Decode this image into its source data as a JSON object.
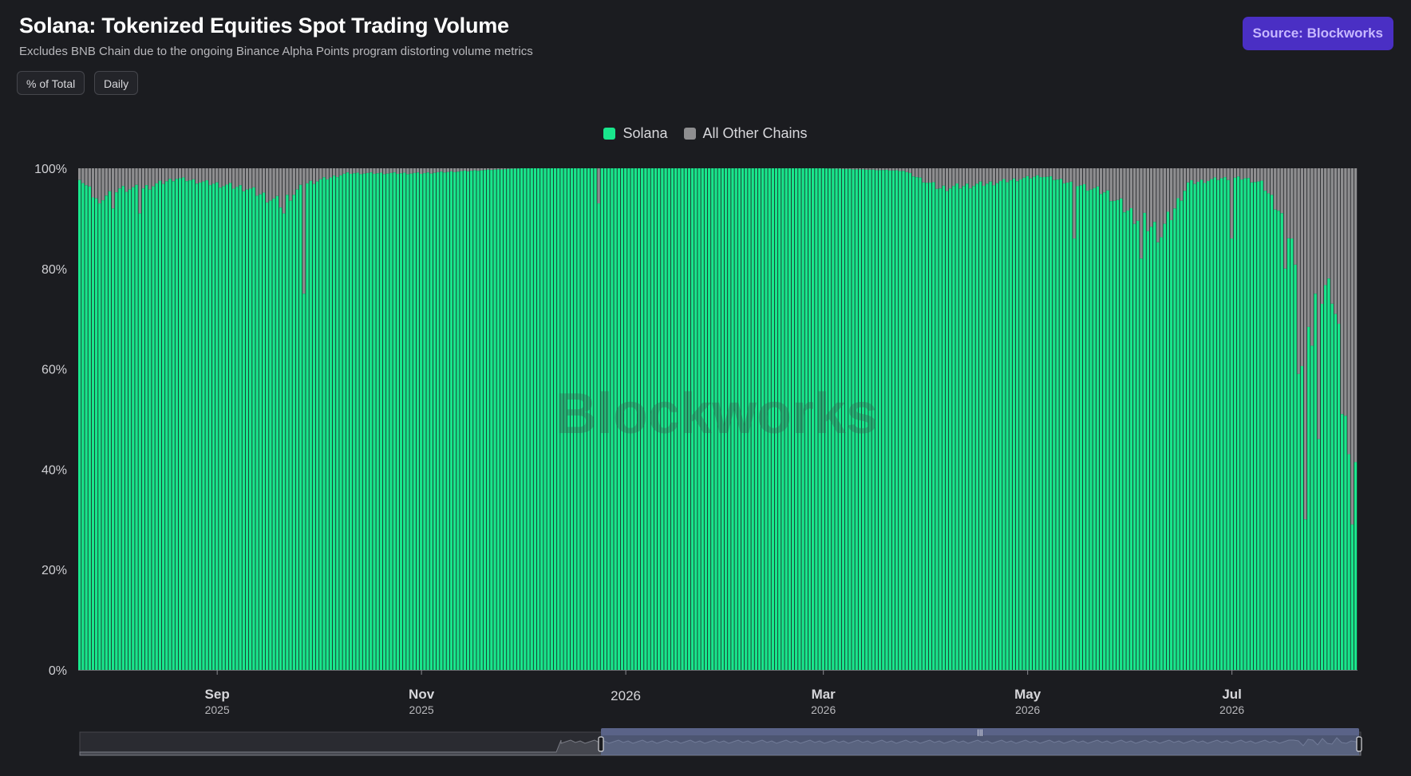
{
  "header": {
    "title": "Solana: Tokenized Equities Spot Trading Volume",
    "subtitle": "Excludes BNB Chain due to the ongoing Binance Alpha Points program distorting volume metrics",
    "source_label": "Source: Blockworks"
  },
  "controls": {
    "mode_label": "% of Total",
    "interval_label": "Daily"
  },
  "watermark": "Blockworks",
  "colors": {
    "solana": "#19e68c",
    "others": "#8e8e90",
    "background": "#1b1c20",
    "accent": "#4a2fc4"
  },
  "chart_data": {
    "type": "bar",
    "stacked": true,
    "normalized": "percent_of_total",
    "x_start": "2025-07-22",
    "x_end": "2026-08-07",
    "interval": "daily",
    "series": [
      {
        "name": "Solana",
        "color": "#19e68c"
      },
      {
        "name": "All Other Chains",
        "color": "#8e8e90"
      }
    ],
    "solana_share_keypoints": [
      [
        "2025-07-22",
        98
      ],
      [
        "2025-07-27",
        94
      ],
      [
        "2025-08-03",
        96
      ],
      [
        "2025-08-10",
        96
      ],
      [
        "2025-08-20",
        98
      ],
      [
        "2025-08-30",
        97
      ],
      [
        "2025-09-10",
        96
      ],
      [
        "2025-09-20",
        93
      ],
      [
        "2025-09-28",
        97
      ],
      [
        "2025-10-10",
        99
      ],
      [
        "2025-11-01",
        99
      ],
      [
        "2025-12-01",
        100
      ],
      [
        "2026-01-01",
        100
      ],
      [
        "2026-02-01",
        100
      ],
      [
        "2026-03-01",
        100
      ],
      [
        "2026-03-25",
        99.5
      ],
      [
        "2026-04-05",
        96
      ],
      [
        "2026-04-20",
        97
      ],
      [
        "2026-05-05",
        98.5
      ],
      [
        "2026-05-15",
        97
      ],
      [
        "2026-05-25",
        95
      ],
      [
        "2026-06-01",
        91
      ],
      [
        "2026-06-10",
        87
      ],
      [
        "2026-06-18",
        97
      ],
      [
        "2026-06-28",
        98
      ],
      [
        "2026-07-05",
        98
      ],
      [
        "2026-07-10",
        97
      ],
      [
        "2026-07-15",
        92
      ],
      [
        "2026-07-19",
        86
      ],
      [
        "2026-07-23",
        55
      ],
      [
        "2026-07-26",
        75
      ],
      [
        "2026-07-29",
        78
      ],
      [
        "2026-08-01",
        74
      ],
      [
        "2026-08-03",
        64
      ],
      [
        "2026-08-05",
        52
      ],
      [
        "2026-08-06",
        38
      ],
      [
        "2026-08-07",
        29
      ]
    ],
    "solana_share_dips": [
      [
        "2025-07-28",
        93
      ],
      [
        "2025-08-01",
        92
      ],
      [
        "2025-08-09",
        91
      ],
      [
        "2025-09-21",
        91
      ],
      [
        "2025-09-27",
        75
      ],
      [
        "2025-12-24",
        93
      ],
      [
        "2026-05-15",
        86
      ],
      [
        "2026-06-04",
        82
      ],
      [
        "2026-07-01",
        86
      ],
      [
        "2026-07-17",
        80
      ],
      [
        "2026-07-21",
        59
      ],
      [
        "2026-07-23",
        30
      ],
      [
        "2026-07-27",
        46
      ],
      [
        "2026-07-31",
        73
      ],
      [
        "2026-08-03",
        51
      ],
      [
        "2026-08-05",
        43
      ],
      [
        "2026-08-06",
        29
      ]
    ],
    "y_range": [
      0,
      100
    ],
    "y_ticks": [
      "0%",
      "20%",
      "40%",
      "60%",
      "80%",
      "100%"
    ],
    "x_ticks": [
      {
        "date": "2025-09-01",
        "label": "Sep",
        "sub": "2025"
      },
      {
        "date": "2025-11-01",
        "label": "Nov",
        "sub": "2025"
      },
      {
        "date": "2026-01-01",
        "label": "2026",
        "sub": ""
      },
      {
        "date": "2026-03-01",
        "label": "Mar",
        "sub": "2026"
      },
      {
        "date": "2026-05-01",
        "label": "May",
        "sub": "2026"
      },
      {
        "date": "2026-07-01",
        "label": "Jul",
        "sub": "2026"
      }
    ],
    "legend_position": "top-center",
    "grid": false
  }
}
